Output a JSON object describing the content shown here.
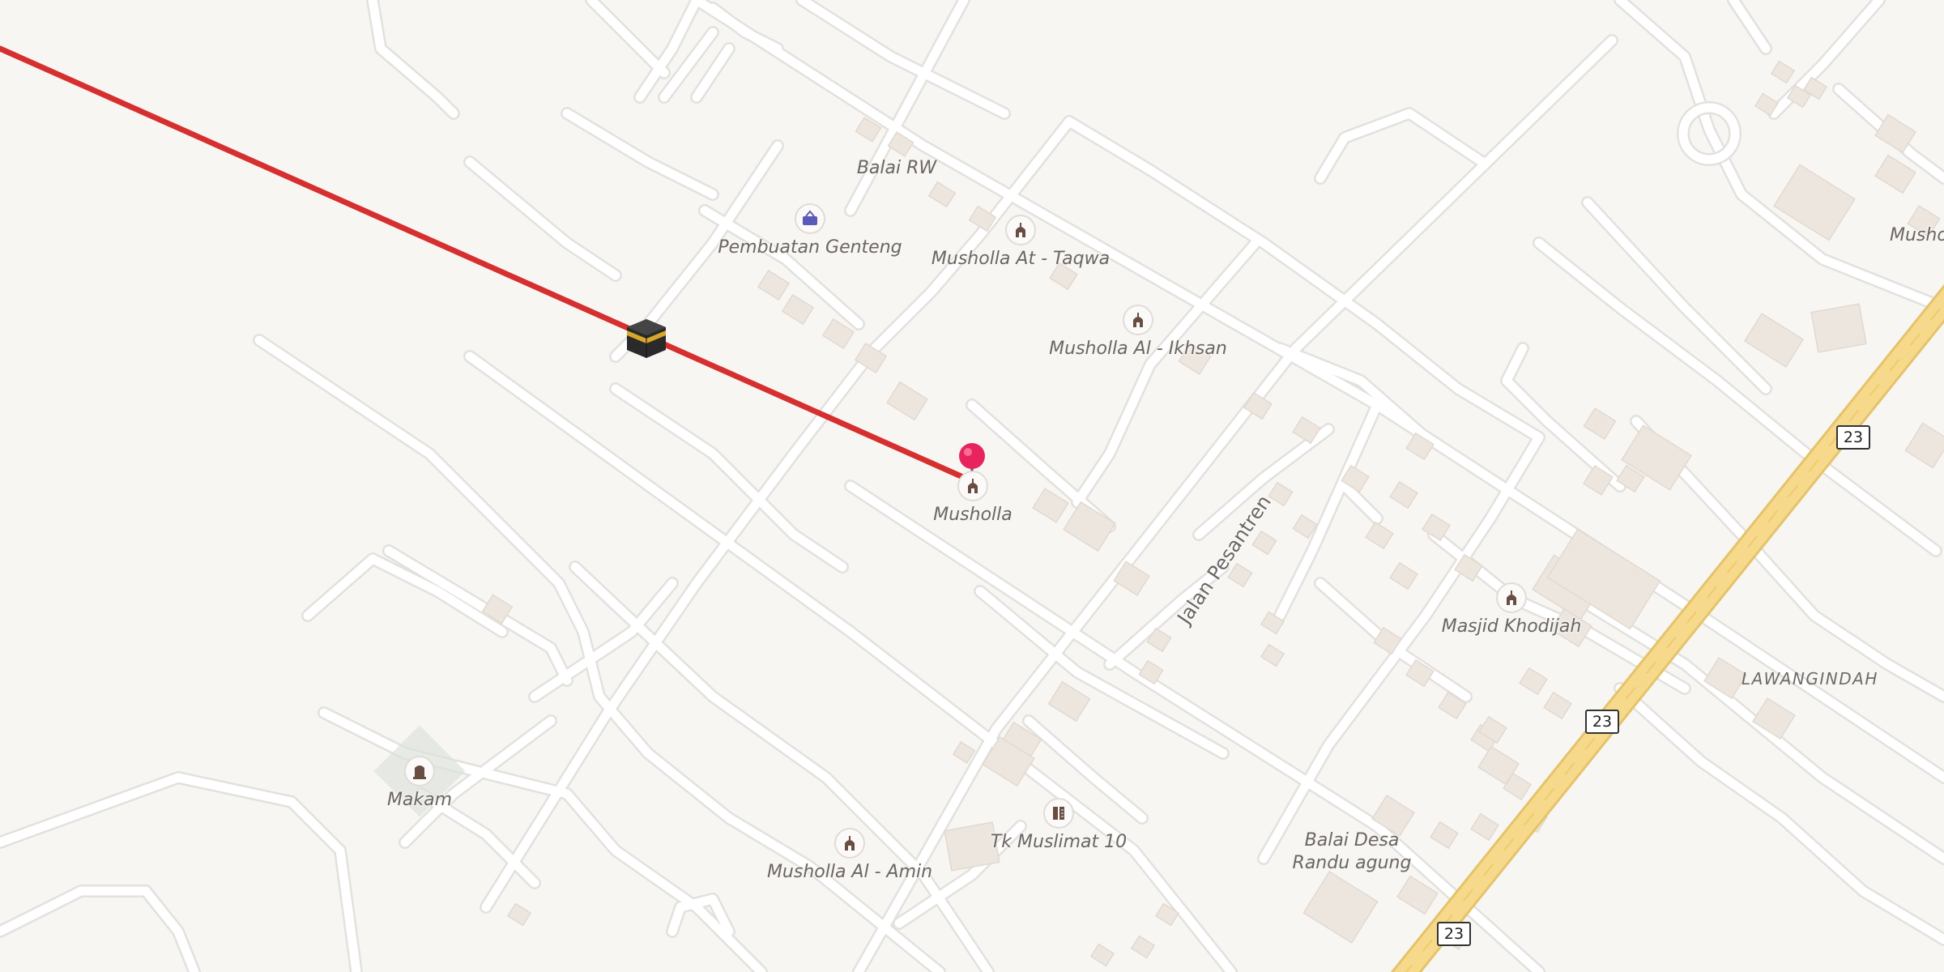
{
  "map": {
    "colors": {
      "background": "#f8f6f3",
      "road": "#ffffff",
      "road_casing": "#e3e1de",
      "highway": "#f7d98c",
      "building": "#ede6df",
      "qibla_line": "#d62f2f",
      "pin": "#e8245e",
      "poi_icon": "#6a4d42"
    },
    "pois": [
      {
        "label": "Balai RW",
        "icon": "none"
      },
      {
        "label": "Pembuatan Genteng",
        "icon": "shopping-basket-icon"
      },
      {
        "label": "Musholla At - Taqwa",
        "icon": "mosque-icon"
      },
      {
        "label": "Musholla Al - Ikhsan",
        "icon": "mosque-icon"
      },
      {
        "label": "Musholla",
        "icon": "mosque-icon"
      },
      {
        "label": "Masjid Khodijah",
        "icon": "mosque-icon"
      },
      {
        "label": "Makam",
        "icon": "grave-icon"
      },
      {
        "label": "Tk Muslimat 10",
        "icon": "school-icon"
      },
      {
        "label": "Musholla Al - Amin",
        "icon": "mosque-icon"
      },
      {
        "label": "Balai Desa\nRandu agung",
        "icon": "none"
      },
      {
        "label": "Musho",
        "icon": "none"
      }
    ],
    "street_label": "Jalan Pesantren",
    "place_label": "LAWANGINDAH",
    "route_shields": [
      "23",
      "23",
      "23"
    ],
    "markers": {
      "kaaba": "kaaba-icon",
      "location_pin": "location-pin-icon"
    }
  }
}
